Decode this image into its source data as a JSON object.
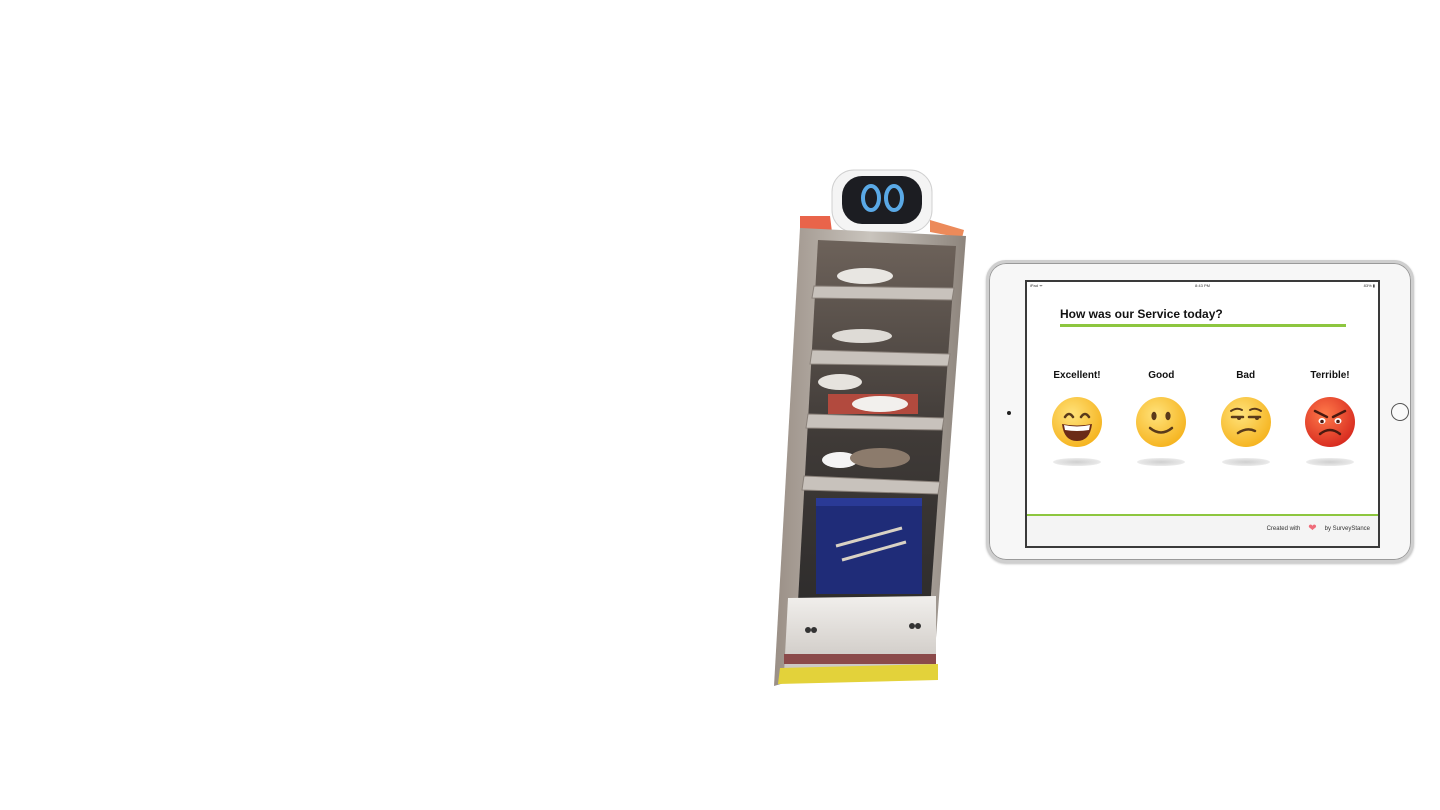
{
  "survey": {
    "status_bar": {
      "carrier": "iPad ᯤ",
      "time": "8:43 PM",
      "battery": "83% ▮"
    },
    "question": "How was our Service today?",
    "options": [
      {
        "label": "Excellent!",
        "icon": "grinning-face-icon"
      },
      {
        "label": "Good",
        "icon": "slightly-smiling-face-icon"
      },
      {
        "label": "Bad",
        "icon": "unamused-face-icon"
      },
      {
        "label": "Terrible!",
        "icon": "angry-face-icon"
      }
    ],
    "footer": {
      "created_with": "Created with",
      "heart_icon": "heart-icon",
      "by": "by SurveyStance"
    }
  },
  "colors": {
    "accent_green": "#8dc63f",
    "heart": "#ef6c7a",
    "emoji_yellow": "#ffc83d",
    "emoji_red": "#e0402a"
  }
}
